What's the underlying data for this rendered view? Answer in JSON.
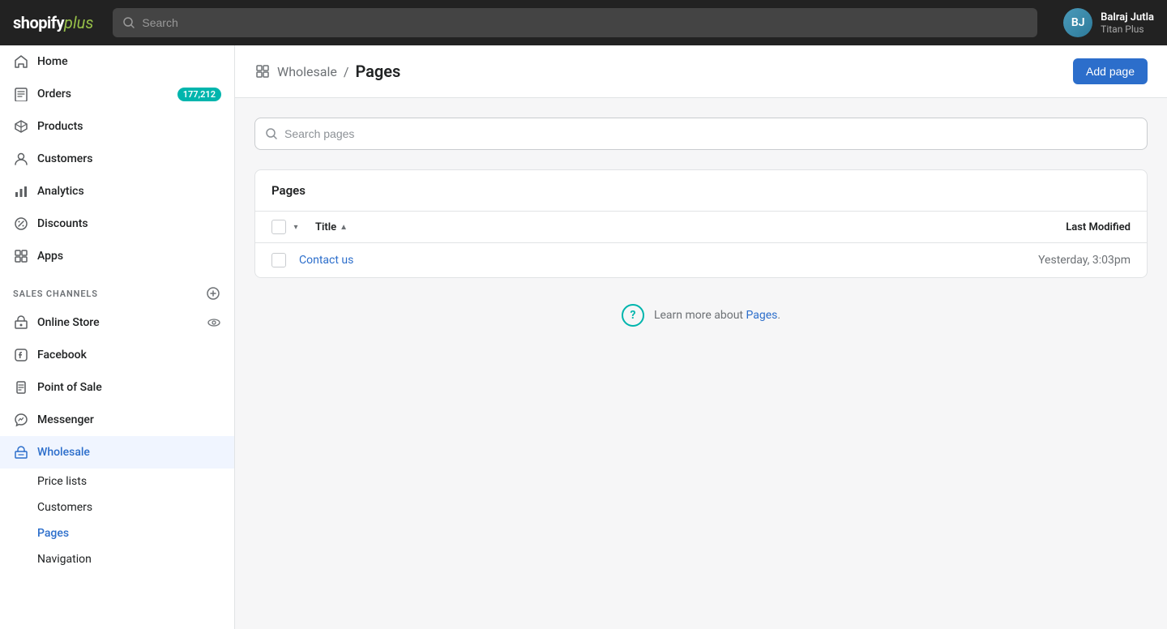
{
  "topNav": {
    "logoShopify": "shopify",
    "logoPlus": "plus",
    "searchPlaceholder": "Search",
    "user": {
      "name": "Balraj Jutla",
      "store": "Titan Plus",
      "initials": "BJ"
    }
  },
  "sidebar": {
    "navItems": [
      {
        "id": "home",
        "label": "Home",
        "icon": "home-icon"
      },
      {
        "id": "orders",
        "label": "Orders",
        "icon": "orders-icon",
        "badge": "177,212"
      },
      {
        "id": "products",
        "label": "Products",
        "icon": "products-icon"
      },
      {
        "id": "customers",
        "label": "Customers",
        "icon": "customers-icon"
      },
      {
        "id": "analytics",
        "label": "Analytics",
        "icon": "analytics-icon"
      },
      {
        "id": "discounts",
        "label": "Discounts",
        "icon": "discounts-icon"
      },
      {
        "id": "apps",
        "label": "Apps",
        "icon": "apps-icon"
      }
    ],
    "salesChannels": {
      "label": "SALES CHANNELS",
      "addLabel": "+",
      "channels": [
        {
          "id": "online-store",
          "label": "Online Store",
          "icon": "store-icon",
          "hasEye": true
        },
        {
          "id": "facebook",
          "label": "Facebook",
          "icon": "facebook-icon"
        },
        {
          "id": "point-of-sale",
          "label": "Point of Sale",
          "icon": "pos-icon"
        },
        {
          "id": "messenger",
          "label": "Messenger",
          "icon": "messenger-icon"
        },
        {
          "id": "wholesale",
          "label": "Wholesale",
          "icon": "wholesale-icon",
          "active": true
        }
      ]
    },
    "wholesaleSubItems": [
      {
        "id": "price-lists",
        "label": "Price lists"
      },
      {
        "id": "customers-sub",
        "label": "Customers"
      },
      {
        "id": "pages",
        "label": "Pages",
        "active": true
      },
      {
        "id": "navigation",
        "label": "Navigation"
      }
    ]
  },
  "breadcrumb": {
    "channelLabel": "Wholesale",
    "separator": "/",
    "currentPage": "Pages"
  },
  "addPageButton": "Add page",
  "searchPages": {
    "placeholder": "Search pages"
  },
  "pagesSection": {
    "title": "Pages",
    "columns": {
      "title": "Title",
      "lastModified": "Last Modified"
    },
    "rows": [
      {
        "title": "Contact us",
        "lastModified": "Yesterday, 3:03pm"
      }
    ]
  },
  "learnMore": {
    "text": "Learn more about ",
    "linkText": "Pages",
    "punctuation": "."
  }
}
